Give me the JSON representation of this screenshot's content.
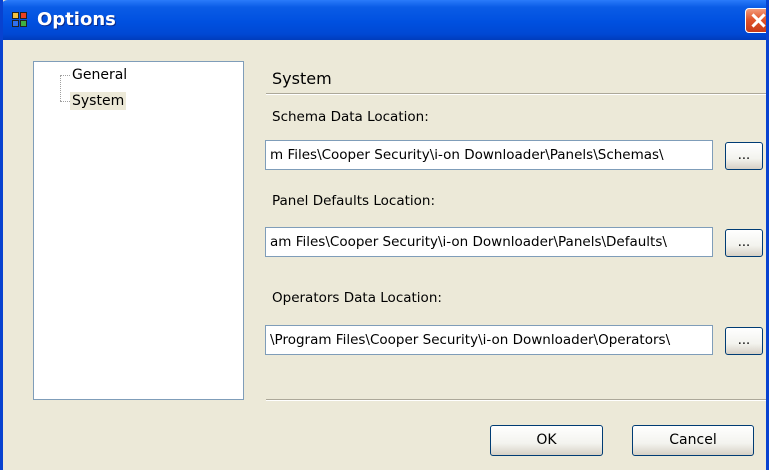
{
  "window": {
    "title": "Options",
    "app_icon": "options-app-icon",
    "close_icon": "close-icon"
  },
  "tree": {
    "items": [
      {
        "label": "General",
        "selected": false
      },
      {
        "label": "System",
        "selected": true
      }
    ]
  },
  "section": {
    "title": "System"
  },
  "fields": [
    {
      "label": "Schema Data Location:",
      "value": "m Files\\Cooper Security\\i-on Downloader\\Panels\\Schemas\\",
      "browse_label": "..."
    },
    {
      "label": "Panel Defaults Location:",
      "value": "am Files\\Cooper Security\\i-on Downloader\\Panels\\Defaults\\",
      "browse_label": "..."
    },
    {
      "label": "Operators Data Location:",
      "value": "\\Program Files\\Cooper Security\\i-on Downloader\\Operators\\",
      "browse_label": "..."
    }
  ],
  "buttons": {
    "ok_label": "OK",
    "cancel_label": "Cancel"
  },
  "colors": {
    "titlebar": "#0050e0",
    "close_button": "#e0552c",
    "dialog_background": "#ece9d8",
    "field_border": "#7f9db9"
  }
}
